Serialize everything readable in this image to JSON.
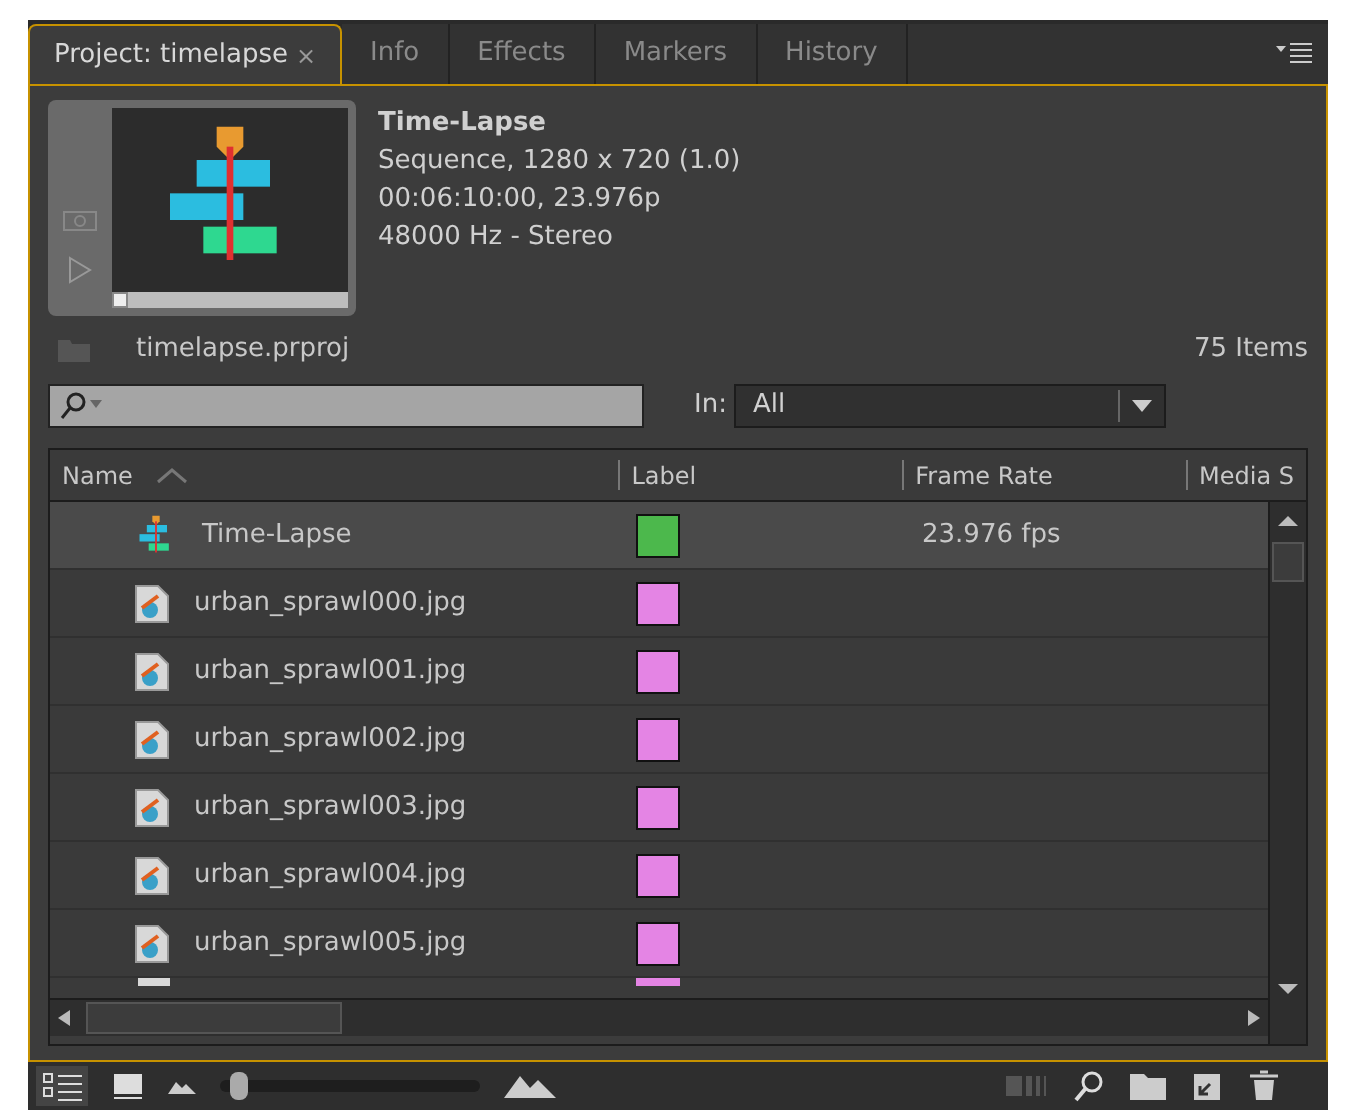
{
  "tabs": [
    {
      "label": "Project: timelapse",
      "selected": true,
      "close": "×"
    },
    {
      "label": "Info",
      "selected": false
    },
    {
      "label": "Effects",
      "selected": false
    },
    {
      "label": "Markers",
      "selected": false
    },
    {
      "label": "History",
      "selected": false
    }
  ],
  "preview": {
    "title": "Time-Lapse",
    "lines": [
      "Sequence, 1280 x 720 (1.0)",
      "00:06:10:00, 23.976p",
      "48000 Hz - Stereo"
    ]
  },
  "project": {
    "file": "timelapse.prproj",
    "count": "75 Items"
  },
  "search": {
    "in_label": "In:",
    "in_value": "All"
  },
  "table": {
    "columns": [
      "Name",
      "Label",
      "Frame Rate",
      "Media S"
    ],
    "rows": [
      {
        "kind": "sequence",
        "name": "Time-Lapse",
        "color": "#4cb84c",
        "frame_rate": "23.976 fps",
        "selected": true
      },
      {
        "kind": "image",
        "name": "urban_sprawl000.jpg",
        "color": "#e484e4",
        "selected": false
      },
      {
        "kind": "image",
        "name": "urban_sprawl001.jpg",
        "color": "#e484e4",
        "selected": false
      },
      {
        "kind": "image",
        "name": "urban_sprawl002.jpg",
        "color": "#e484e4",
        "selected": false
      },
      {
        "kind": "image",
        "name": "urban_sprawl003.jpg",
        "color": "#e484e4",
        "selected": false
      },
      {
        "kind": "image",
        "name": "urban_sprawl004.jpg",
        "color": "#e484e4",
        "selected": false
      },
      {
        "kind": "image",
        "name": "urban_sprawl005.jpg",
        "color": "#e484e4",
        "selected": false
      }
    ],
    "partial_row": {
      "color": "#e484e4"
    }
  },
  "zoom": {
    "level": 0.04
  }
}
